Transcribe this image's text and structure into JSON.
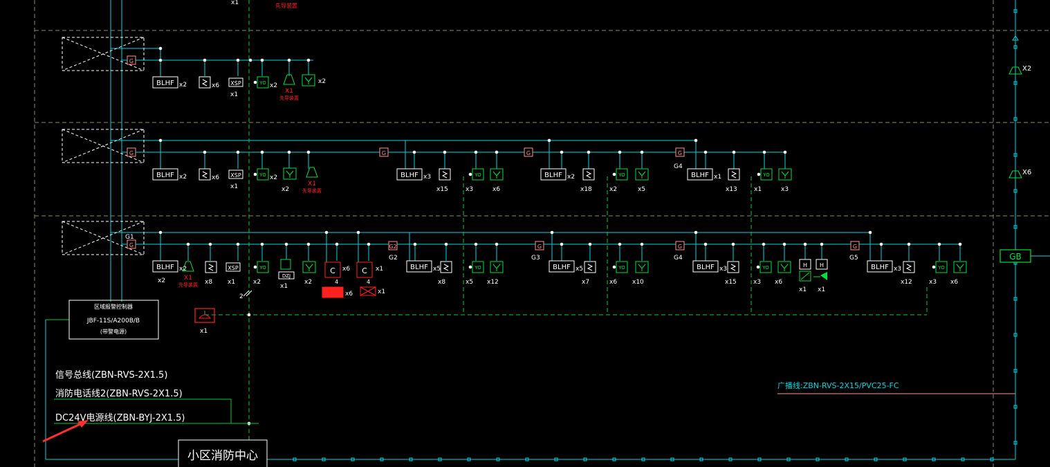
{
  "colors": {
    "background": "#000000",
    "bus": "#00d8e0",
    "dashed_green": "#00cc33",
    "grid_dashed": "#8a8a6a",
    "white": "#ffffff",
    "red": "#ff2020",
    "green_symbol": "#00e040",
    "pink": "#ff9090"
  },
  "top": {
    "x1_label": "x1",
    "red_note": "先导装置"
  },
  "row1": {
    "blhf": "BLHF",
    "blhf_count": "x2",
    "smoke_count": "x6",
    "xsp": "XSP",
    "xsp_count": "x1",
    "module_count": "x2",
    "alarm_count": "X1",
    "alarm_note": "先导装置",
    "speaker_count": "x2",
    "isolator": "G"
  },
  "row2": {
    "isolator": "G",
    "g_labels": [
      "G",
      "G",
      "G4"
    ],
    "groups": [
      {
        "blhf": "BLHF",
        "blhf_count": "x2",
        "smoke_count": "x6",
        "xsp": "XSP",
        "xsp_count": "x1",
        "module_count": "x2",
        "speaker_count": "x2",
        "alarm_count": "X1",
        "alarm_note": "先导装置"
      },
      {
        "blhf": "BLHF",
        "blhf_count": "x3",
        "smoke_count": "x15",
        "module_count": "x3",
        "speaker_count": "x6"
      },
      {
        "blhf": "BLHF",
        "blhf_count": "x2",
        "smoke_count": "x18",
        "module_count": "x2",
        "speaker_count": "x5"
      },
      {
        "blhf": "BLHF",
        "blhf_count": "x1",
        "smoke_count": "x13",
        "module_count": "x1",
        "speaker_count": "x3"
      }
    ]
  },
  "row3": {
    "g1": "G1",
    "g_small": "G",
    "g_labels": [
      "G2",
      "G3",
      "G4",
      "G5"
    ],
    "groups": [
      {
        "blhf": "BLHF",
        "blhf_count": "x2",
        "alarm_count": "X1",
        "alarm_note": "先导装置",
        "smoke_count": "x8",
        "xsp": "XSP",
        "xsp_count": "x1",
        "module_count": "x2",
        "dzj": "DZJ",
        "dzj_count": "x1",
        "speaker_count": "x2",
        "c1_count": "x6",
        "c1_sub": "4",
        "red_block_count": "x6",
        "c2_count": "x1",
        "c2_sub": "4",
        "valve_count": "x1"
      },
      {
        "blhf": "BLHF",
        "blhf_count": "x5",
        "smoke_count": "x8",
        "module_count": "x5",
        "speaker_count": "x12"
      },
      {
        "blhf": "BLHF",
        "blhf_count": "x5",
        "smoke_count": "x7",
        "module_count": "x6",
        "speaker_count": "x10"
      },
      {
        "blhf": "BLHF",
        "blhf_count": "x3",
        "smoke_count": "x15",
        "module_count": "x3",
        "speaker_count": "x6",
        "h1_count": "x1",
        "h2_count": "x1"
      },
      {
        "blhf": "BLHF",
        "blhf_count": "x3",
        "smoke_count": "x12",
        "module_count": "x3",
        "speaker_count": "x6"
      }
    ]
  },
  "controller": {
    "line1": "区域报警控制器",
    "line2": "JBF-11S/A200B/B",
    "line3": "(带警电源)"
  },
  "phone": {
    "count": "x1",
    "wire_count": "2"
  },
  "legend": {
    "signal": "信号总线(ZBN-RVS-2X1.5)",
    "phone": "消防电话线2(ZBN-RVS-2X1.5)",
    "power": "DC24V电源线(ZBN-BYJ-2X1.5)"
  },
  "center": {
    "label": "小区消防中心"
  },
  "broadcast": {
    "line": "广播线:ZBN-RVS-2X15/PVC25-FC",
    "gb": "GB",
    "x2": "X2",
    "x6": "X6"
  }
}
